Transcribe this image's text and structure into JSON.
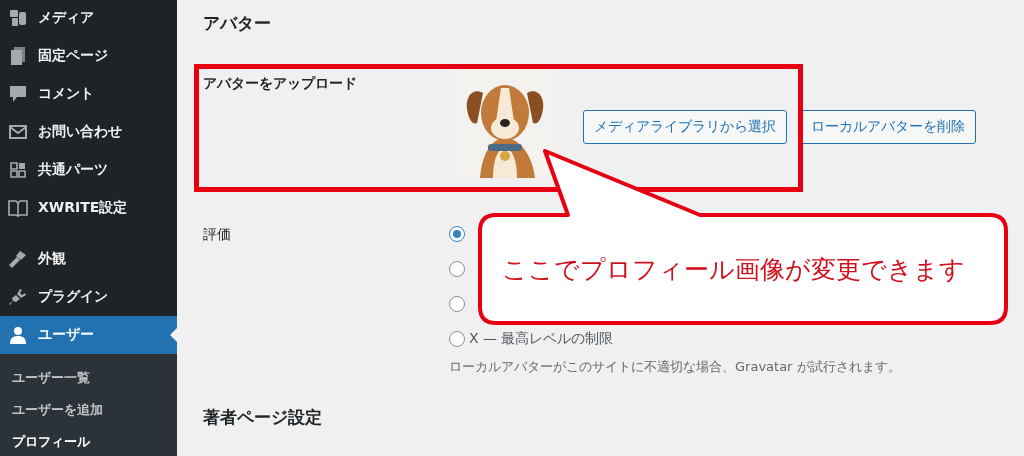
{
  "sidebar": {
    "groups": [
      [
        {
          "label": "メディア",
          "selected": false
        },
        {
          "label": "固定ページ",
          "selected": false
        },
        {
          "label": "コメント",
          "selected": false
        },
        {
          "label": "お問い合わせ",
          "selected": false
        },
        {
          "label": "共通パーツ",
          "selected": false
        },
        {
          "label": "XWRITE設定",
          "selected": false
        }
      ],
      [
        {
          "label": "外観",
          "selected": false
        },
        {
          "label": "プラグイン",
          "selected": false
        },
        {
          "label": "ユーザー",
          "selected": true
        }
      ]
    ],
    "submenu": [
      {
        "label": "ユーザー一覧",
        "selected": false
      },
      {
        "label": "ユーザーを追加",
        "selected": false
      },
      {
        "label": "プロフィール",
        "selected": true
      }
    ]
  },
  "main": {
    "heading": "アバター",
    "upload": {
      "label": "アバターをアップロード",
      "buttons": [
        "メディアライブラリから選択",
        "ローカルアバターを削除"
      ]
    },
    "rating": {
      "label": "評価",
      "options": [
        {
          "selected": true
        },
        {
          "selected": false
        },
        {
          "selected": false
        },
        {
          "label": "X — 最高レベルの制限",
          "selected": false
        }
      ],
      "description": "ローカルアバターがこのサイトに不適切な場合、Gravatar が試行されます。"
    },
    "next_heading": "著者ページ設定"
  },
  "annotation": {
    "text": "ここでプロフィール画像が変更できます"
  }
}
